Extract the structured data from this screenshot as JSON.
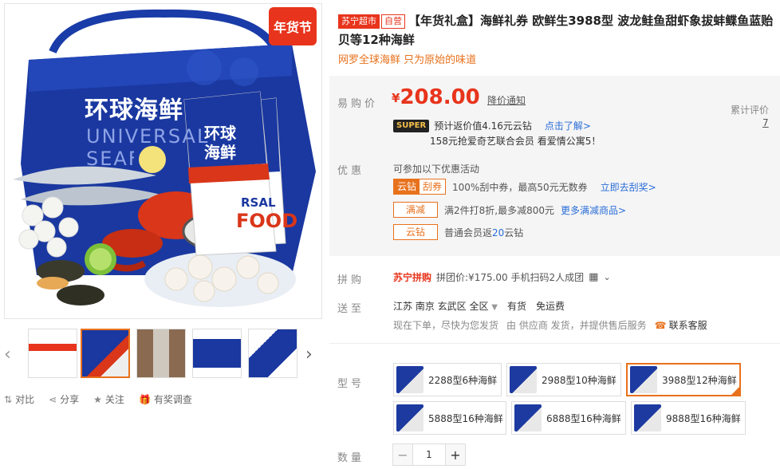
{
  "gallery": {
    "badge": "年货节",
    "box_title": "环球海鲜",
    "box_subtitle_1": "UNIVERSAL",
    "box_subtitle_2": "SEAFOOD",
    "card_title": "环球海鲜",
    "card_en_1": "RSAL",
    "card_en_2": "FOOD"
  },
  "thumbnails": {
    "count": 5,
    "active_index": 1
  },
  "actions": [
    {
      "icon": "compare-icon",
      "label": "对比"
    },
    {
      "icon": "share-icon",
      "label": "分享"
    },
    {
      "icon": "star-icon",
      "label": "关注"
    },
    {
      "icon": "gift-icon",
      "label": "有奖调查"
    }
  ],
  "product": {
    "tag_store": "苏宁超市",
    "tag_self": "自营",
    "title": "【年货礼盒】海鲜礼券 欧鲜生3988型 波龙鲑鱼甜虾象拔蚌鲽鱼蓝贻贝等12种海鲜",
    "subtitle": "网罗全球海鲜 只为原始的味道"
  },
  "price": {
    "label": "易购价",
    "currency": "¥",
    "value": "208.00",
    "notify": "降价通知",
    "review_label": "累计评价",
    "review_count": "7",
    "super_badge": "SUPER",
    "cashback": "预计返价值4.16元云钻",
    "learn_more": "点击了解>",
    "promo_line": "158元抢爱奇艺联合会员 看爱情公寓5！"
  },
  "offers": {
    "label": "优惠",
    "intro": "可参加以下优惠活动",
    "scratch_tag_1": "云钻",
    "scratch_tag_2": "刮券",
    "scratch_text": "100%刮中券，最高50元无数券",
    "scratch_link": "立即去刮奖>",
    "discount_tag": "满减",
    "discount_text": "满2件打8折,最多减800元",
    "discount_link": "更多满减商品>",
    "diamond_tag": "云钻",
    "diamond_text_pre": "普通会员返",
    "diamond_num": "20",
    "diamond_text_post": "云钻"
  },
  "group": {
    "label": "拼购",
    "logo": "苏宁拼购",
    "text": "拼团价:¥175.00 手机扫码2人成团"
  },
  "delivery": {
    "label": "送至",
    "region": "江苏 南京 玄武区 全区",
    "stock": "有货",
    "freight": "免运费",
    "note_pre": "现在下单，尽快为您发货",
    "note_mid": "由 供应商 发货，并提供售后服务",
    "service": "联系客服"
  },
  "models": {
    "label": "型号",
    "items": [
      "2288型6种海鲜",
      "2988型10种海鲜",
      "3988型12种海鲜",
      "5888型16种海鲜",
      "6888型16种海鲜",
      "9888型16种海鲜"
    ],
    "selected": 2
  },
  "quantity": {
    "label": "数量",
    "minus": "−",
    "value": "1",
    "plus": "+"
  },
  "colors": {
    "accent": "#e8341c",
    "orange": "#e8711c",
    "link": "#2a6dd8",
    "brand_blue": "#1c3aa0"
  }
}
